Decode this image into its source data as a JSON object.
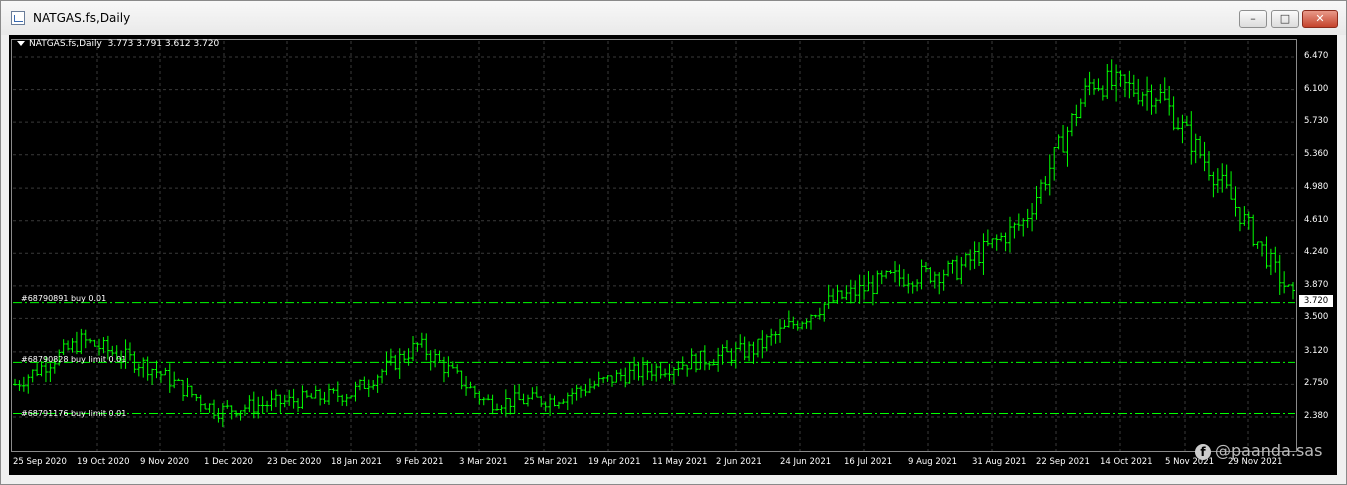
{
  "window": {
    "title": "NATGAS.fs,Daily",
    "controls": [
      "minimize",
      "maximize",
      "close"
    ]
  },
  "chart_info": {
    "symbol": "NATGAS.fs,Daily",
    "ohlc": "3.773 3.791 3.612 3.720"
  },
  "orders": [
    {
      "label": "#68790891 buy 0.01",
      "price": 3.68
    },
    {
      "label": "#68790828 buy limit 0.01",
      "price": 3.0
    },
    {
      "label": "#68791176 buy limit 0.01",
      "price": 2.42
    }
  ],
  "price_axis": [
    "6.470",
    "6.100",
    "5.730",
    "5.360",
    "4.980",
    "4.610",
    "4.240",
    "3.870",
    "3.500",
    "3.120",
    "2.750",
    "2.380"
  ],
  "current_price": "3.720",
  "date_axis": [
    "25 Sep 2020",
    "19 Oct 2020",
    "9 Nov 2020",
    "1 Dec 2020",
    "23 Dec 2020",
    "18 Jan 2021",
    "9 Feb 2021",
    "3 Mar 2021",
    "25 Mar 2021",
    "19 Apr 2021",
    "11 May 2021",
    "2 Jun 2021",
    "24 Jun 2021",
    "16 Jul 2021",
    "9 Aug 2021",
    "31 Aug 2021",
    "22 Sep 2021",
    "14 Oct 2021",
    "5 Nov 2021",
    "29 Nov 2021"
  ],
  "watermark": "@paanda.sas",
  "colors": {
    "bars": "#00ff00",
    "order_line": "#00ff00",
    "grid": "#3a3a3a",
    "background": "#000000"
  },
  "chart_data": {
    "type": "line",
    "ylim": [
      2.1,
      6.6
    ],
    "x": [
      "25 Sep 2020",
      "19 Oct 2020",
      "9 Nov 2020",
      "1 Dec 2020",
      "23 Dec 2020",
      "18 Jan 2021",
      "9 Feb 2021",
      "3 Mar 2021",
      "25 Mar 2021",
      "19 Apr 2021",
      "11 May 2021",
      "2 Jun 2021",
      "24 Jun 2021",
      "16 Jul 2021",
      "9 Aug 2021",
      "31 Aug 2021",
      "22 Sep 2021",
      "14 Oct 2021",
      "5 Nov 2021",
      "29 Nov 2021"
    ],
    "series": [
      {
        "values": [
          2.75,
          3.25,
          2.95,
          2.45,
          2.55,
          2.65,
          3.2,
          2.55,
          2.58,
          2.85,
          3.0,
          3.15,
          3.65,
          3.95,
          4.05,
          4.6,
          6.2,
          6.05,
          4.95,
          3.72
        ]
      }
    ]
  }
}
